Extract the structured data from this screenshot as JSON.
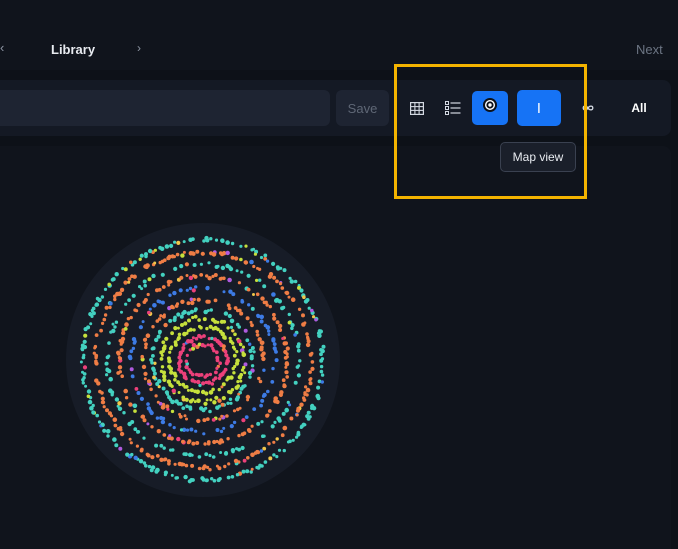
{
  "header": {
    "title": "Library",
    "back_glyph": "‹",
    "forward_glyph": "›",
    "next_label": "Next"
  },
  "toolbar": {
    "search_value": "",
    "save_label": "Save",
    "view_buttons": [
      {
        "name": "grid-view-button",
        "icon": "grid-icon",
        "active": false
      },
      {
        "name": "list-view-button",
        "icon": "list-icon",
        "active": false
      },
      {
        "name": "map-view-button",
        "icon": "radial-map-icon",
        "active": true
      },
      {
        "name": "timeline-view-button",
        "icon": "bar-icon",
        "active": true
      },
      {
        "name": "infinite-view-button",
        "icon": "infinity-icon",
        "active": false
      }
    ],
    "all_label": "All"
  },
  "tooltip": {
    "text": "Map view"
  },
  "colors": {
    "accent": "#1673f5",
    "highlight": "#f4b400",
    "ring_palette": [
      "#ec407a",
      "#c6e03c",
      "#43d1c0",
      "#ef7d45",
      "#3d7be5",
      "#f0c64a",
      "#b05ae0"
    ]
  }
}
